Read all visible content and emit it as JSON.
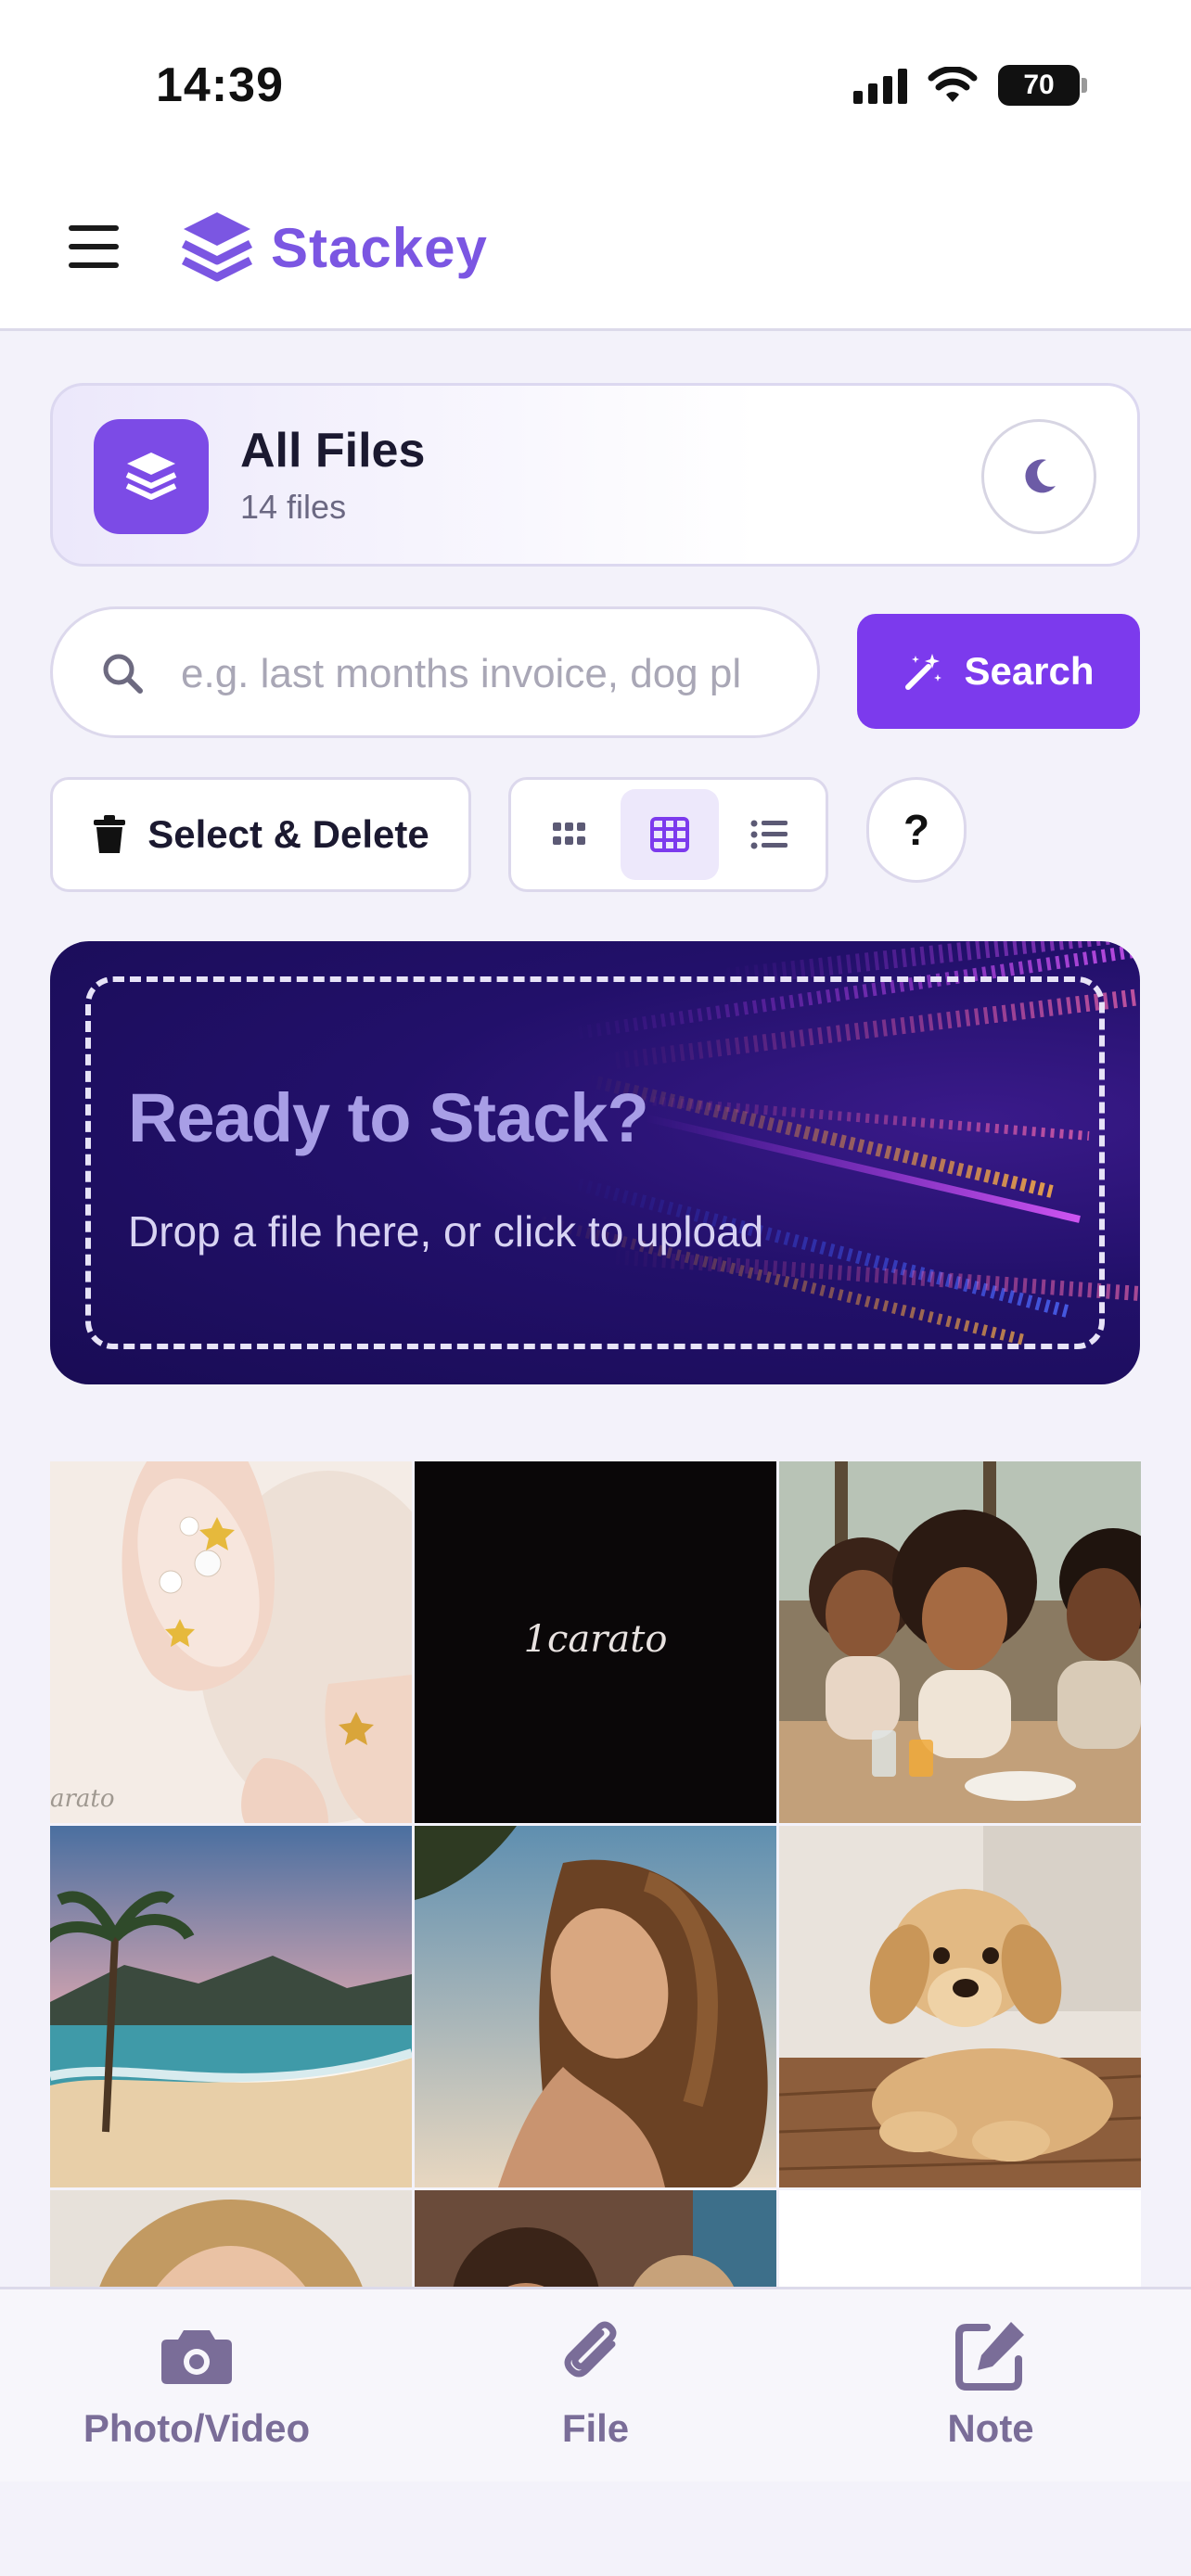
{
  "status_bar": {
    "time": "14:39",
    "battery": "70"
  },
  "header": {
    "app_name": "Stackey"
  },
  "files_card": {
    "title": "All Files",
    "count": "14 files"
  },
  "search": {
    "placeholder": "e.g. last months invoice, dog pl",
    "button_label": "Search"
  },
  "controls": {
    "select_delete_label": "Select & Delete",
    "help_label": "?",
    "view_modes": [
      "small-grid",
      "grid",
      "list"
    ],
    "active_view": "grid"
  },
  "dropzone": {
    "title": "Ready to Stack?",
    "subtitle": "Drop a file here, or click to upload"
  },
  "grid_items": [
    {
      "kind": "nail art photo",
      "caption": "arato"
    },
    {
      "kind": "logo",
      "caption": "1carato"
    },
    {
      "kind": "friends dining photo"
    },
    {
      "kind": "beach sunset photo"
    },
    {
      "kind": "woman at beach photo"
    },
    {
      "kind": "golden retriever puppy photo"
    },
    {
      "kind": "portrait photo"
    },
    {
      "kind": "group photo"
    },
    {
      "kind": "blank"
    }
  ],
  "tabbar": {
    "items": [
      {
        "label": "Photo/Video",
        "icon": "camera-icon"
      },
      {
        "label": "File",
        "icon": "paperclip-icon"
      },
      {
        "label": "Note",
        "icon": "edit-note-icon"
      }
    ]
  },
  "colors": {
    "accent": "#7c3aed",
    "logo": "#7b56e2",
    "banner_bg": "#1f0f5e"
  }
}
